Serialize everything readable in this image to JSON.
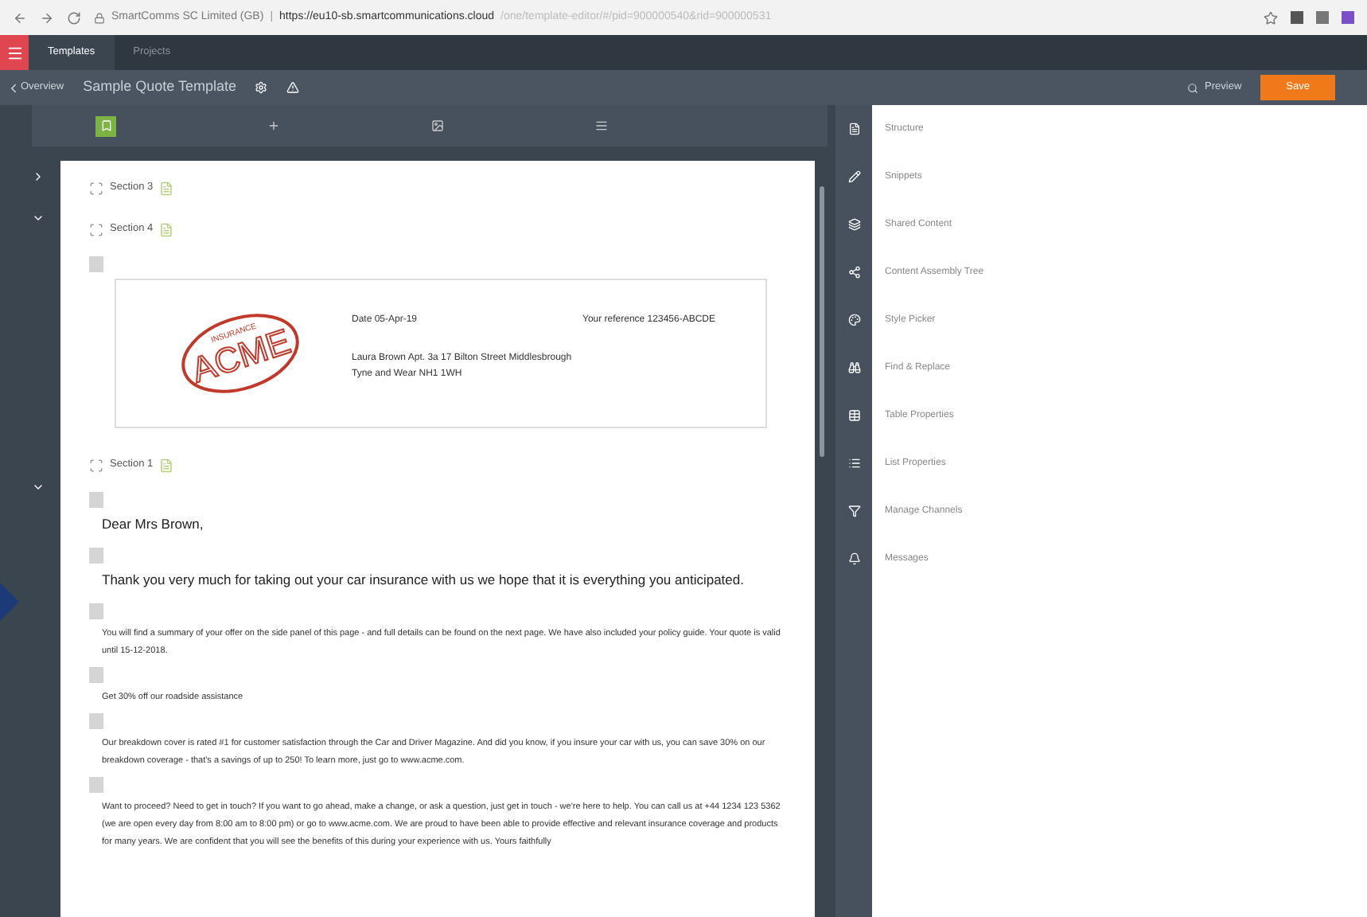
{
  "browser": {
    "site": "SmartComms SC Limited (GB)",
    "separator": "|",
    "url_host": "https://eu10-sb.smartcommunications.cloud",
    "url_path": "/one/template-editor/#/pid=900000540&rid=900000531"
  },
  "app_tabs": [
    {
      "label": "Templates",
      "selected": true
    },
    {
      "label": "Projects",
      "selected": false
    }
  ],
  "header": {
    "back": "Overview",
    "title": "Sample Quote Template",
    "preview": "Preview",
    "save": "Save"
  },
  "sections": [
    {
      "label": "Section 3",
      "expanded": false
    },
    {
      "label": "Section 4",
      "expanded": true,
      "blocks": [
        {
          "kind": "letterhead",
          "logo": "ACME",
          "logo_arc": "INSURANCE",
          "date": "Date 05-Apr-19",
          "reference": "Your reference 123456-ABCDE",
          "address_1": "Laura Brown Apt. 3a 17 Bilton Street Middlesbrough",
          "address_2": "Tyne and Wear NH1 1WH"
        }
      ]
    },
    {
      "label": "Section 1",
      "expanded": true,
      "blocks": [
        {
          "kind": "large",
          "text": "Dear Mrs Brown,"
        },
        {
          "kind": "large",
          "text": "Thank you very much for taking out your car insurance with us we hope that it is everything you anticipated."
        },
        {
          "kind": "small",
          "text": "You will find a summary of your offer on the side panel of this page - and full details can be found on the next page. We have also included your policy guide. Your quote is valid until 15-12-2018."
        },
        {
          "kind": "small",
          "text": "Get 30% off our roadside assistance"
        },
        {
          "kind": "small",
          "text": "Our breakdown cover is rated #1 for customer satisfaction through the Car and Driver Magazine. And did you know, if you insure your car with us, you can save 30% on our breakdown coverage - that's a savings of up to 250! To learn more, just go to www.acme.com."
        },
        {
          "kind": "small",
          "text": "Want to proceed? Need to get in touch? If you want to go ahead, make a change, or ask a question, just get in touch - we're here to help. You can call us at +44 1234 123 5362 (we are open every day from 8:00 am to 8:00 pm) or go to www.acme.com. We are proud to have been able to provide effective and relevant insurance coverage and products for many years. We are confident that you will see the benefits of this during your experience with us. Yours faithfully"
        }
      ]
    }
  ],
  "panel_items": [
    "Structure",
    "Snippets",
    "Shared Content",
    "Content Assembly Tree",
    "Style Picker",
    "Find & Replace",
    "Table Properties",
    "List Properties",
    "Manage Channels",
    "Messages"
  ]
}
